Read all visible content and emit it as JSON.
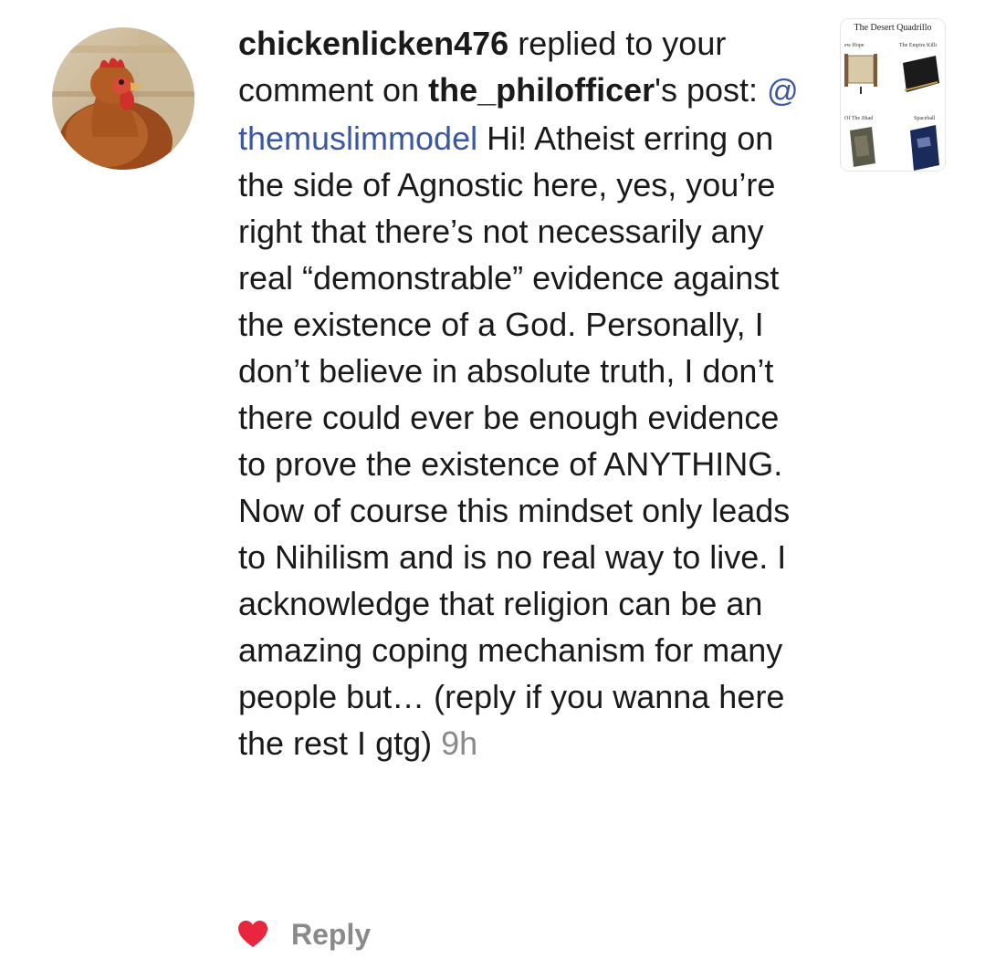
{
  "notification": {
    "username": "chickenlicken476",
    "action_text": " replied to your comment on ",
    "post_author": "the_philofficer",
    "post_suffix": "'s post: ",
    "mention_symbol": "@",
    "mention_name": "themuslimmodel",
    "body": " Hi! Atheist erring on the side of Agnostic here, yes, you’re right that there’s not necessarily any real “demonstrable” evidence against the existence of a God. Personally, I don’t believe in absolute truth, I don’t there could ever be enough evidence to prove the existence of ANYTHING. Now of course this mindset only leads to Nihilism and is no real way to live. I acknowledge that religion can be an amazing coping mechanism for many people but… (reply if you wanna here the rest I gtg) ",
    "timestamp": "9h"
  },
  "avatar": {
    "icon": "chicken-profile-photo"
  },
  "post_thumbnail": {
    "title": "The Desert Quadrillo",
    "labels": [
      "ew Hope",
      "The Empire Killi",
      "Of The Jihad",
      "Spaceball"
    ]
  },
  "actions": {
    "liked": true,
    "reply_label": "Reply"
  },
  "colors": {
    "mention": "#3a57a6",
    "muted": "#8a8a8a",
    "heart": "#e8263d",
    "text": "#1a1a1a"
  }
}
